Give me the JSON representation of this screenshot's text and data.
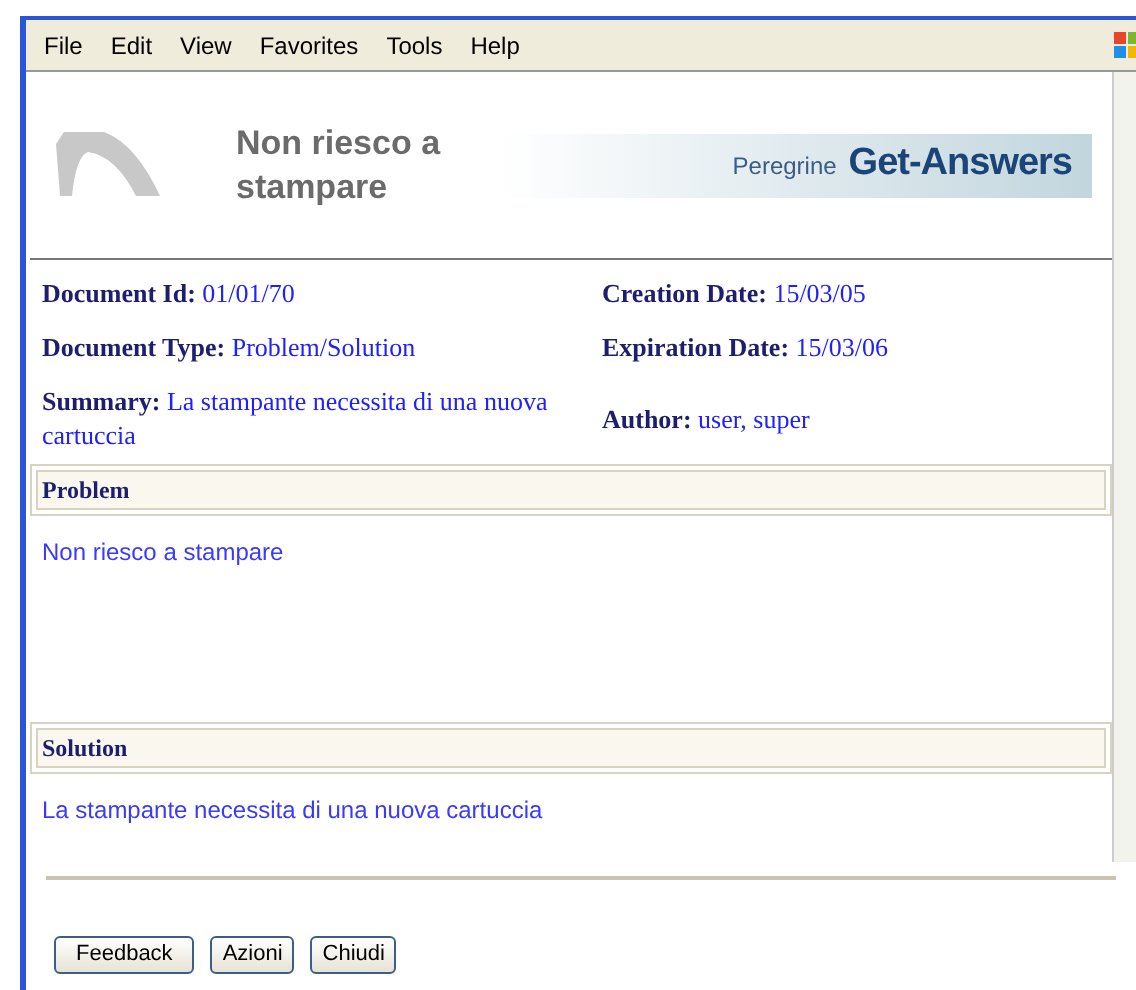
{
  "menu": [
    "File",
    "Edit",
    "View",
    "Favorites",
    "Tools",
    "Help"
  ],
  "header": {
    "title": "Non riesco a stampare",
    "brand_small": "Peregrine",
    "brand_large": "Get-Answers"
  },
  "fields": [
    {
      "label": "Document Id:",
      "value": "01/01/70"
    },
    {
      "label": "Creation Date:",
      "value": "15/03/05"
    },
    {
      "label": "Document Type:",
      "value": "Problem/Solution"
    },
    {
      "label": "Expiration Date:",
      "value": "15/03/06"
    },
    {
      "label": "Summary:",
      "value": "La stampante necessita di una nuova cartuccia"
    },
    {
      "label": "Author:",
      "value": "user, super"
    }
  ],
  "sections": [
    {
      "title": "Problem",
      "text": "Non riesco a stampare"
    },
    {
      "title": "Solution",
      "text": "La stampante necessita di una nuova cartuccia"
    }
  ],
  "buttons": [
    "Feedback",
    "Azioni",
    "Chiudi"
  ]
}
